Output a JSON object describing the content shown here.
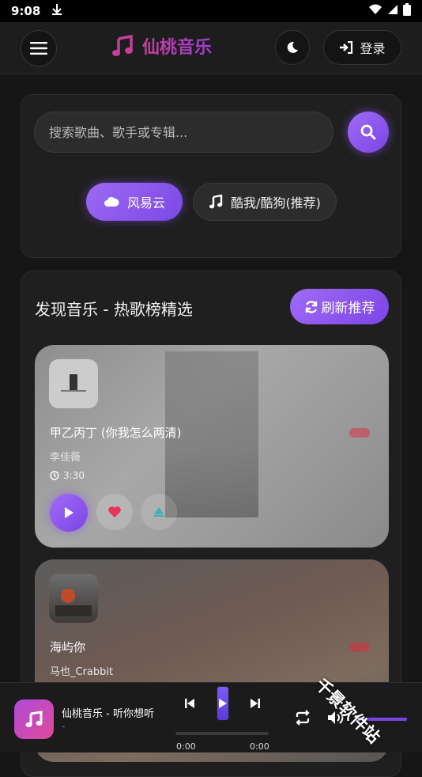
{
  "status_bar": {
    "time": "9:08"
  },
  "header": {
    "brand": "仙桃音乐",
    "login_label": "登录"
  },
  "search": {
    "placeholder": "搜索歌曲、歌手或专辑...",
    "sources": [
      {
        "label": "风易云",
        "active": true
      },
      {
        "label": "酷我/酷狗(推荐)",
        "active": false
      }
    ]
  },
  "discover": {
    "title": "发现音乐 - 热歌榜精选",
    "refresh_label": "刷新推荐",
    "songs": [
      {
        "title": "甲乙丙丁 (你我怎么两清)",
        "artist": "李佳薇",
        "duration": "3:30"
      },
      {
        "title": "海屿你",
        "artist": "马也_Crabbit"
      }
    ]
  },
  "player": {
    "title": "仙桃音乐 - 听你想听",
    "subtitle": "-",
    "current_time": "0:00",
    "total_time": "0:00",
    "progress": 0
  },
  "watermark": "千景软件站",
  "colors": {
    "accent": "#8a5cf0",
    "brand_pink": "#c53f99",
    "background": "#161616"
  }
}
